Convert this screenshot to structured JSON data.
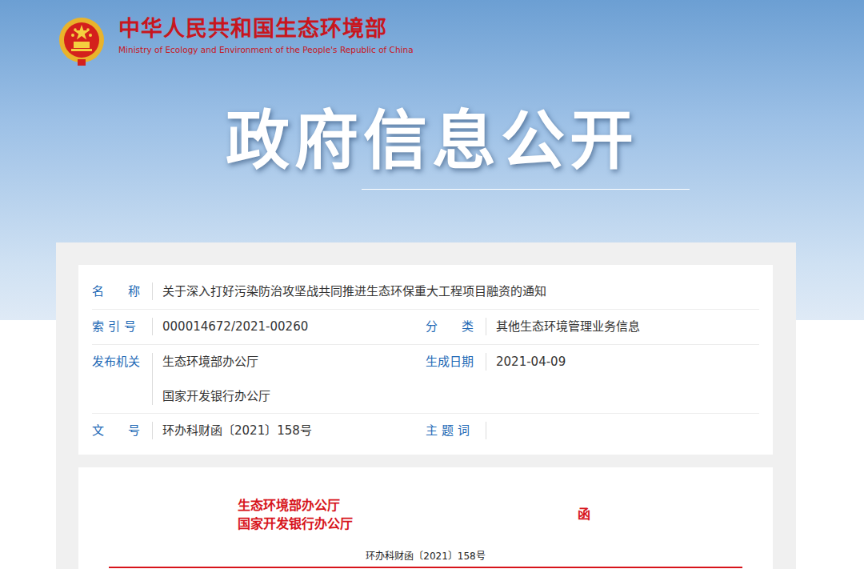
{
  "header": {
    "site_name": "中华人民共和国生态环境部",
    "site_name_en": "Ministry of Ecology and Environment of the People's Republic of China",
    "banner_title": "政府信息公开"
  },
  "meta_rows": [
    {
      "cells": [
        {
          "label": "名　　称",
          "values": [
            "关于深入打好污染防治攻坚战共同推进生态环保重大工程项目融资的通知"
          ]
        }
      ]
    },
    {
      "cells": [
        {
          "label": "索 引 号",
          "values": [
            "000014672/2021-00260"
          ]
        },
        {
          "label": "分　　类",
          "values": [
            "其他生态环境管理业务信息"
          ]
        }
      ]
    },
    {
      "cells": [
        {
          "label": "发布机关",
          "values": [
            "生态环境部办公厅",
            "国家开发银行办公厅"
          ]
        },
        {
          "label": "生成日期",
          "values": [
            "2021-04-09"
          ]
        }
      ]
    },
    {
      "cells": [
        {
          "label": "文　　号",
          "values": [
            "环办科财函〔2021〕158号"
          ]
        },
        {
          "label": "主 题 词",
          "values": []
        }
      ]
    }
  ],
  "document": {
    "issuers": [
      "生态环境部办公厅",
      "国家开发银行办公厅"
    ],
    "doc_type": "函",
    "doc_number": "环办科财函〔2021〕158号"
  }
}
